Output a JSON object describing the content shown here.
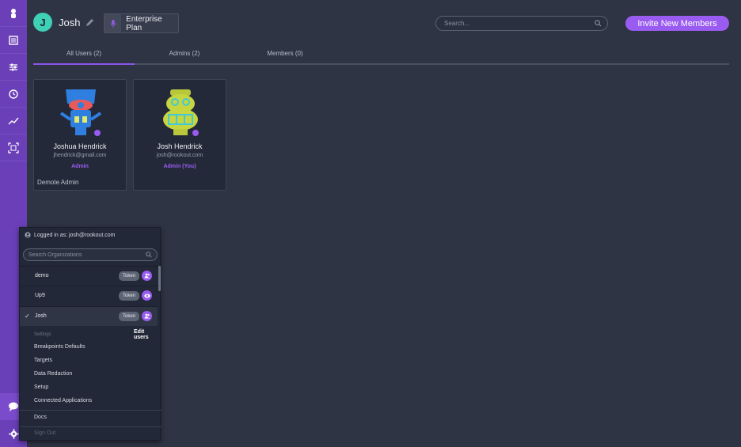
{
  "header": {
    "avatar_letter": "J",
    "org_name": "Josh",
    "plan_label": "Enterprise Plan",
    "search_placeholder": "Search...",
    "invite_label": "Invite New Members"
  },
  "tabs": [
    {
      "label": "All Users (2)",
      "active": true
    },
    {
      "label": "Admins (2)",
      "active": false
    },
    {
      "label": "Members (0)",
      "active": false
    }
  ],
  "users": [
    {
      "name": "Joshua Hendrick",
      "email": "jhendrick@gmail.com",
      "role": "Admin",
      "action": "Demote Admin",
      "avatar": "blue-robot-icon"
    },
    {
      "name": "Josh Hendrick",
      "email": "josh@rookout.com",
      "role": "Admin (You)",
      "action": "",
      "avatar": "yellow-robot-icon"
    }
  ],
  "org_menu": {
    "logged_in": "Logged in as: josh@rookout.com",
    "search_placeholder": "Search Organizations",
    "orgs": [
      {
        "name": "demo",
        "token": "Token",
        "selected": false,
        "role_icon": "users-icon"
      },
      {
        "name": "Up9",
        "token": "Token",
        "selected": false,
        "role_icon": "eye-icon"
      },
      {
        "name": "Josh",
        "token": "Token",
        "selected": true,
        "role_icon": "users-icon"
      }
    ],
    "tooltip": "Edit users",
    "settings_heading": "Settings",
    "settings_items": [
      "Breakpoints Defaults",
      "Targets",
      "Data Redaction",
      "Setup",
      "Connected Applications"
    ],
    "docs": "Docs",
    "sign_out": "Sign Out"
  },
  "colors": {
    "sidebar": "#6a3fb8",
    "accent": "#9a5cf0",
    "background": "#2e3443",
    "avatar": "#3fd0b8"
  }
}
